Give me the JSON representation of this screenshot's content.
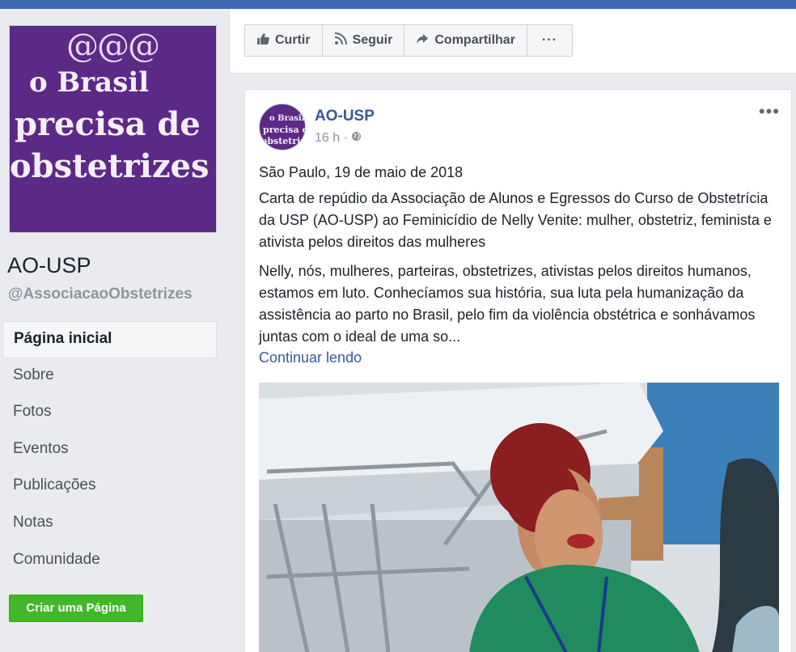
{
  "colors": {
    "brand_blue": "#4267b2",
    "link": "#385898",
    "green_button": "#42b72a",
    "cover_purple": "#5b2a86"
  },
  "cover_image": {
    "lines": [
      "o Brasil",
      "precisa de",
      "obstetrizes"
    ]
  },
  "page": {
    "name": "AO-USP",
    "handle": "@AssociacaoObstetrizes"
  },
  "nav": {
    "items": [
      {
        "label": "Página inicial",
        "active": true
      },
      {
        "label": "Sobre"
      },
      {
        "label": "Fotos"
      },
      {
        "label": "Eventos"
      },
      {
        "label": "Publicações"
      },
      {
        "label": "Notas"
      },
      {
        "label": "Comunidade"
      }
    ],
    "create_page": "Criar uma Página"
  },
  "actions": {
    "like": {
      "label": "Curtir",
      "icon": "thumbs-up-icon"
    },
    "follow": {
      "label": "Seguir",
      "icon": "rss-icon"
    },
    "share": {
      "label": "Compartilhar",
      "icon": "share-arrow-icon"
    },
    "more": "···"
  },
  "post": {
    "author": "AO-USP",
    "time": "16 h ·",
    "more": "•••",
    "avatar_lines": [
      "o Brasil",
      "precisa de",
      "obstetrizes"
    ],
    "paragraphs": [
      "São Paulo, 19 de maio de 2018",
      "Carta de repúdio da Associação de Alunos e Egressos do Curso de Obstetrícia da USP (AO-USP) ao Feminicídio de Nelly Venite: mulher, obstetriz, feminista e ativista pelos direitos das mulheres",
      "Nelly, nós, mulheres, parteiras, obstetrizes, ativistas pelos direitos humanos, estamos em luto. Conhecíamos sua história, sua luta pela humanização da assistência ao parto no Brasil, pelo fim da violência obstétrica e sonhávamos juntas com o ideal de uma so..."
    ],
    "continue_link": "Continuar lendo"
  }
}
